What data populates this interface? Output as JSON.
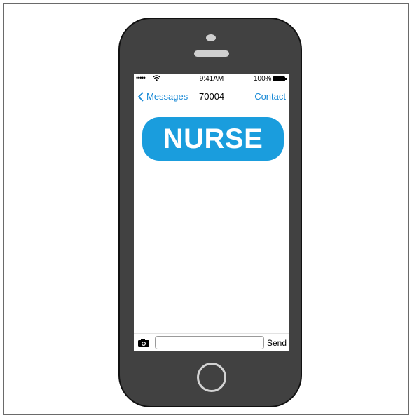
{
  "status_bar": {
    "signal": "•••••",
    "time": "9:41AM",
    "battery_percent": "100%"
  },
  "nav": {
    "back_label": "Messages",
    "title": "70004",
    "contact_label": "Contact"
  },
  "message": {
    "text": "NURSE",
    "bubble_color": "#1a9ddd"
  },
  "composer": {
    "placeholder": "",
    "value": "",
    "send_label": "Send"
  },
  "colors": {
    "phone_body": "#414141",
    "accent": "#1a8ad6"
  },
  "icons": {
    "wifi": "wifi-icon",
    "battery": "battery-icon",
    "back": "chevron-left-icon",
    "camera": "camera-icon"
  }
}
